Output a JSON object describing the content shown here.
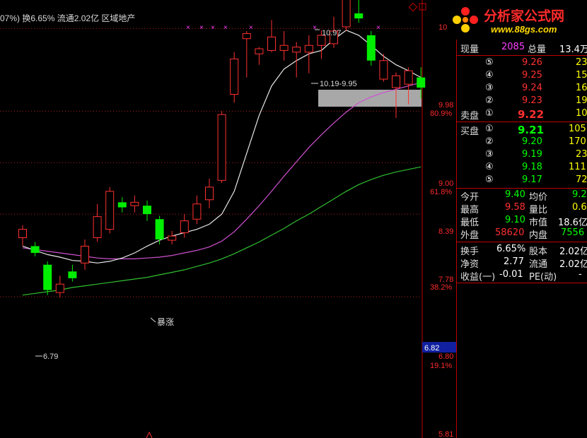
{
  "header": {
    "text": "07%) 换6.65% 流通2.02亿 区域地产"
  },
  "logo": {
    "title": "分析家公式网",
    "url": "www.88gs.com"
  },
  "chart_data": {
    "type": "candlestick",
    "price_labels": [
      "10",
      "9.98",
      "9.00",
      "8.39",
      "7.78",
      "6.82",
      "6.80",
      "5.81"
    ],
    "percent_labels": [
      "80.9%",
      "61.8%",
      "38.2%",
      "19.1%"
    ],
    "current_price_box": "6.82",
    "annotations": {
      "high": "10.97",
      "range": "10.19-9.95",
      "low": "6.79",
      "surge": "暴涨"
    },
    "candles": [
      {
        "o": 7.5,
        "c": 7.6,
        "h": 7.65,
        "l": 7.4
      },
      {
        "o": 7.4,
        "c": 7.32,
        "h": 7.45,
        "l": 7.28
      },
      {
        "o": 7.18,
        "c": 6.88,
        "h": 7.22,
        "l": 6.82
      },
      {
        "o": 6.85,
        "c": 6.95,
        "h": 7.05,
        "l": 6.79
      },
      {
        "o": 7.1,
        "c": 7.02,
        "h": 7.18,
        "l": 6.98
      },
      {
        "o": 7.2,
        "c": 7.4,
        "h": 7.48,
        "l": 7.12
      },
      {
        "o": 7.5,
        "c": 7.75,
        "h": 7.9,
        "l": 7.45
      },
      {
        "o": 7.6,
        "c": 8.05,
        "h": 8.1,
        "l": 7.55
      },
      {
        "o": 7.92,
        "c": 7.86,
        "h": 7.98,
        "l": 7.8
      },
      {
        "o": 7.88,
        "c": 7.92,
        "h": 8.0,
        "l": 7.8
      },
      {
        "o": 7.88,
        "c": 7.78,
        "h": 7.94,
        "l": 7.7
      },
      {
        "o": 7.72,
        "c": 7.48,
        "h": 7.76,
        "l": 7.42
      },
      {
        "o": 7.47,
        "c": 7.52,
        "h": 7.58,
        "l": 7.42
      },
      {
        "o": 7.56,
        "c": 7.7,
        "h": 7.78,
        "l": 7.5
      },
      {
        "o": 7.72,
        "c": 7.9,
        "h": 8.0,
        "l": 7.66
      },
      {
        "o": 7.95,
        "c": 8.1,
        "h": 8.2,
        "l": 7.85
      },
      {
        "o": 8.18,
        "c": 8.96,
        "h": 9.0,
        "l": 8.15
      },
      {
        "o": 9.2,
        "c": 9.62,
        "h": 9.7,
        "l": 9.1
      },
      {
        "o": 9.86,
        "c": 9.92,
        "h": 9.95,
        "l": 9.4
      },
      {
        "o": 9.68,
        "c": 9.74,
        "h": 9.76,
        "l": 9.55
      },
      {
        "o": 9.72,
        "c": 9.88,
        "h": 10.08,
        "l": 9.7
      },
      {
        "o": 9.72,
        "c": 9.78,
        "h": 9.95,
        "l": 9.6
      },
      {
        "o": 9.7,
        "c": 9.76,
        "h": 9.82,
        "l": 9.4
      },
      {
        "o": 9.7,
        "c": 9.78,
        "h": 9.9,
        "l": 9.45
      },
      {
        "o": 9.78,
        "c": 9.9,
        "h": 9.96,
        "l": 9.62
      },
      {
        "o": 9.8,
        "c": 9.95,
        "h": 10.12,
        "l": 9.75
      },
      {
        "o": 10.0,
        "c": 10.5,
        "h": 10.55,
        "l": 9.95
      },
      {
        "o": 10.16,
        "c": 10.1,
        "h": 10.97,
        "l": 10.05
      },
      {
        "o": 9.9,
        "c": 9.6,
        "h": 9.95,
        "l": 9.54
      },
      {
        "o": 9.38,
        "c": 9.6,
        "h": 9.68,
        "l": 9.35
      },
      {
        "o": 9.28,
        "c": 9.42,
        "h": 9.46,
        "l": 8.92
      },
      {
        "o": 9.32,
        "c": 9.48,
        "h": 9.52,
        "l": 9.08
      },
      {
        "o": 9.4,
        "c": 9.28,
        "h": 9.52,
        "l": 9.15
      }
    ],
    "ma_white": [
      7.4,
      7.35,
      7.3,
      7.27,
      7.23,
      7.22,
      7.2,
      7.22,
      7.26,
      7.32,
      7.4,
      7.47,
      7.52,
      7.56,
      7.6,
      7.66,
      7.78,
      8.05,
      8.5,
      8.95,
      9.3,
      9.5,
      9.6,
      9.68,
      9.72,
      9.85,
      9.96,
      9.9,
      9.78,
      9.65,
      9.55,
      9.48,
      9.4
    ],
    "ma_magenta": [
      7.38,
      7.36,
      7.34,
      7.32,
      7.3,
      7.28,
      7.26,
      7.25,
      7.25,
      7.25,
      7.26,
      7.27,
      7.29,
      7.32,
      7.35,
      7.39,
      7.46,
      7.57,
      7.72,
      7.88,
      8.05,
      8.23,
      8.4,
      8.57,
      8.72,
      8.86,
      8.99,
      9.1,
      9.17,
      9.22,
      9.26,
      9.3,
      9.34
    ],
    "ma_green": [
      6.82,
      6.84,
      6.86,
      6.88,
      6.91,
      6.93,
      6.95,
      6.97,
      6.99,
      7.01,
      7.03,
      7.06,
      7.09,
      7.12,
      7.16,
      7.2,
      7.25,
      7.31,
      7.38,
      7.45,
      7.53,
      7.61,
      7.7,
      7.78,
      7.87,
      7.96,
      8.05,
      8.13,
      8.19,
      8.24,
      8.28,
      8.31,
      8.34
    ]
  },
  "quote": {
    "now_label": "现量",
    "now_value": "2085",
    "total_label": "总量",
    "total_value": "13.4万",
    "sell_label": "卖盘",
    "buy_label": "买盘",
    "sell": [
      {
        "idx": "⑤",
        "price": "9.26",
        "vol": "23"
      },
      {
        "idx": "④",
        "price": "9.25",
        "vol": "15"
      },
      {
        "idx": "③",
        "price": "9.24",
        "vol": "16"
      },
      {
        "idx": "②",
        "price": "9.23",
        "vol": "19"
      },
      {
        "idx": "①",
        "price": "9.22",
        "vol": "10"
      }
    ],
    "buy": [
      {
        "idx": "①",
        "price": "9.21",
        "vol": "105"
      },
      {
        "idx": "②",
        "price": "9.20",
        "vol": "170"
      },
      {
        "idx": "③",
        "price": "9.19",
        "vol": "23"
      },
      {
        "idx": "④",
        "price": "9.18",
        "vol": "111"
      },
      {
        "idx": "⑤",
        "price": "9.17",
        "vol": "72"
      }
    ],
    "stats": [
      {
        "l1": "今开",
        "v1": "9.40",
        "l2": "均价",
        "v2": "9.2"
      },
      {
        "l1": "最高",
        "v1": "9.58",
        "l2": "量比",
        "v2": "0.6"
      },
      {
        "l1": "最低",
        "v1": "9.10",
        "l2": "市值",
        "v2": "18.6亿"
      },
      {
        "l1": "外盘",
        "v1": "58620",
        "l2": "内盘",
        "v2": "7556"
      }
    ],
    "fund": [
      {
        "l1": "换手",
        "v1": "6.65%",
        "l2": "股本",
        "v2": "2.02亿"
      },
      {
        "l1": "净资",
        "v1": "2.77",
        "l2": "流通",
        "v2": "2.02亿"
      },
      {
        "l1": "收益(一)",
        "v1": "-0.01",
        "l2": "PE(动)",
        "v2": "-"
      }
    ]
  }
}
